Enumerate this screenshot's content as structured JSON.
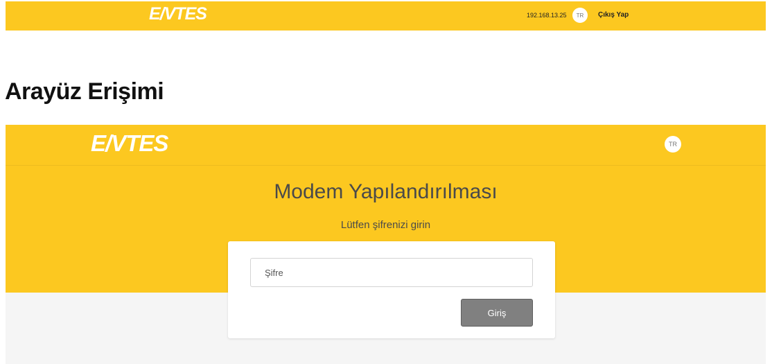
{
  "top_bar": {
    "logo": "E/VTES",
    "ip_address": "192.168.13.25",
    "language": "TR",
    "logout_label": "Çıkış Yap",
    "background_color": "#fcc820"
  },
  "heading": "Arayüz Erişimi",
  "login_page": {
    "logo": "E/VTES",
    "language": "TR",
    "title": "Modem Yapılandırılması",
    "subtitle": "Lütfen şifrenizi girin",
    "password_placeholder": "Şifre",
    "login_button_label": "Giriş",
    "background_color": "#fcc820",
    "button_color": "#808080"
  }
}
